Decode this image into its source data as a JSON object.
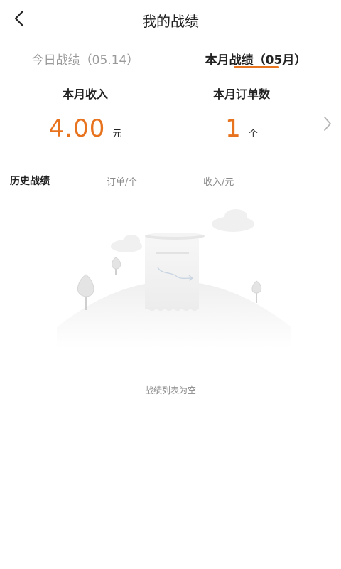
{
  "header": {
    "title": "我的战绩",
    "back_icon": "chevron-left-icon"
  },
  "tabs": [
    {
      "label": "今日战绩（05.14）",
      "active": false
    },
    {
      "label": "本月战绩（05月）",
      "active": true
    }
  ],
  "accent_color": "#e8731f",
  "stats": {
    "income": {
      "label": "本月收入",
      "value": "4.00",
      "unit": "元"
    },
    "orders": {
      "label": "本月订单数",
      "value": "1",
      "unit": "个"
    },
    "more_icon": "chevron-right-icon"
  },
  "history": {
    "title": "历史战绩",
    "columns": [
      "订单/个",
      "收入/元"
    ]
  },
  "empty_state": {
    "illustration_icon": "empty-receipt-illustration",
    "text": "战绩列表为空"
  }
}
